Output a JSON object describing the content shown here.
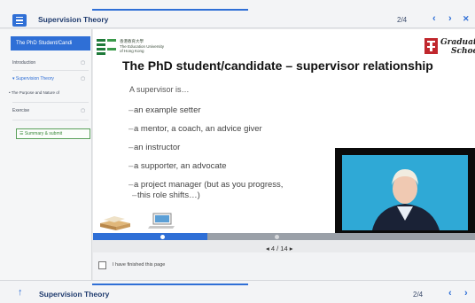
{
  "header": {
    "title": "Supervision Theory",
    "counter": "2/4",
    "prev_icon": "‹",
    "next_icon": "›",
    "close_icon": "✕"
  },
  "sidebar": {
    "active_item": "The PhD Student/Candi",
    "items": [
      {
        "label": "Introduction",
        "mark": "▢"
      },
      {
        "label": "▾ Supervision Theory",
        "mark": "▢"
      },
      {
        "label": "• The Purpose and Nature of",
        "mark": ""
      },
      {
        "label": "Exercise",
        "mark": "▢"
      }
    ],
    "summary_label": "☰ Summary & submit"
  },
  "slide": {
    "logo_text": [
      "香港教育大學",
      "The Education University",
      "of Hong Kong"
    ],
    "grad_logo_text": [
      "Graduat",
      "Schoo"
    ],
    "title": "The PhD student/candidate – supervisor relationship",
    "intro": "A supervisor is…",
    "bullets": [
      "an example setter",
      "a mentor, a coach, an advice giver",
      "an instructor",
      "a supporter, an advocate",
      "a project manager (but as you progress,",
      "this role shifts…)"
    ]
  },
  "media": {
    "progress_pct": 30,
    "page_indicator": "◂ 4 / 14 ▸"
  },
  "finish": {
    "label": "I have finished this page"
  },
  "footer": {
    "title": "Supervision Theory",
    "counter": "2/4",
    "prev_icon": "‹",
    "next_icon": "›",
    "up_icon": "↑"
  },
  "colors": {
    "accent": "#2f6fd6",
    "video_bg": "#2fa9d6"
  }
}
